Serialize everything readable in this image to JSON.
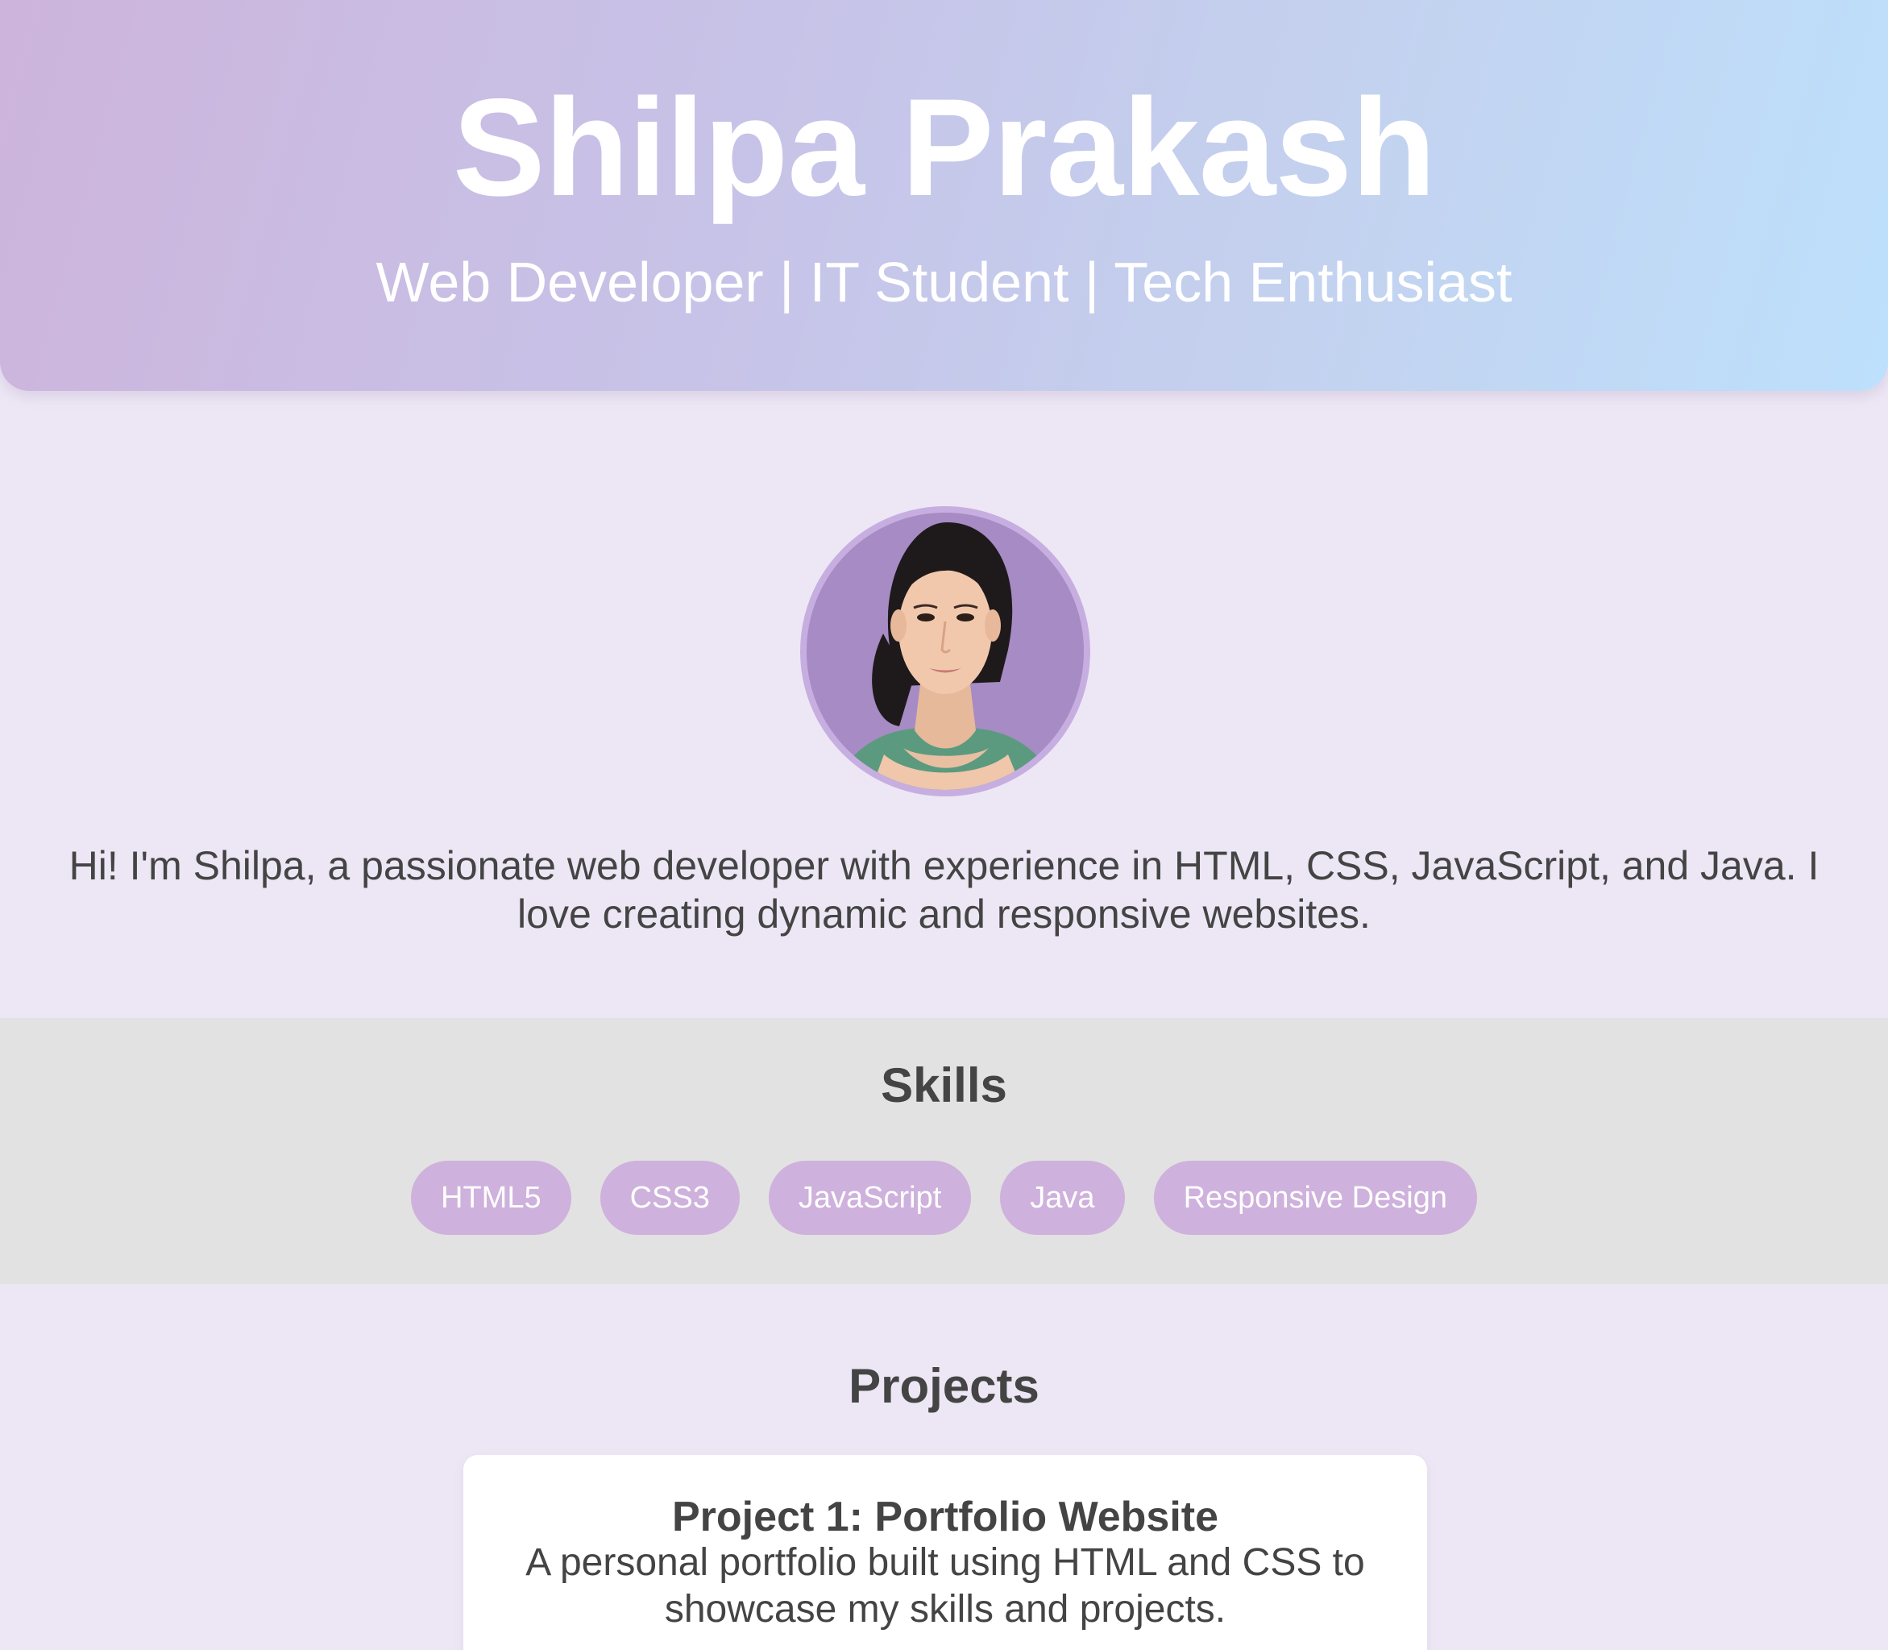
{
  "header": {
    "name": "Shilpa Prakash",
    "tagline": "Web Developer | IT Student | Tech Enthusiast"
  },
  "about": {
    "avatar": "profile-photo",
    "text": "Hi! I'm Shilpa, a passionate web developer with experience in HTML, CSS, JavaScript, and Java. I love creating dynamic and responsive websites."
  },
  "skills": {
    "title": "Skills",
    "items": [
      {
        "label": "HTML5"
      },
      {
        "label": "CSS3"
      },
      {
        "label": "JavaScript"
      },
      {
        "label": "Java"
      },
      {
        "label": "Responsive Design"
      }
    ]
  },
  "projects": {
    "title": "Projects",
    "items": [
      {
        "title": "Project 1: Portfolio Website",
        "description": "A personal portfolio built using HTML and CSS to showcase my skills and projects."
      }
    ]
  },
  "colors": {
    "page_background": "#ede7f5",
    "skills_band": "#e2e2e2",
    "pill": "#ceb1dc",
    "avatar_border": "#c7aee0",
    "text": "#444444",
    "gradient_start": "#cdb4dc",
    "gradient_end": "#bde0fc"
  }
}
